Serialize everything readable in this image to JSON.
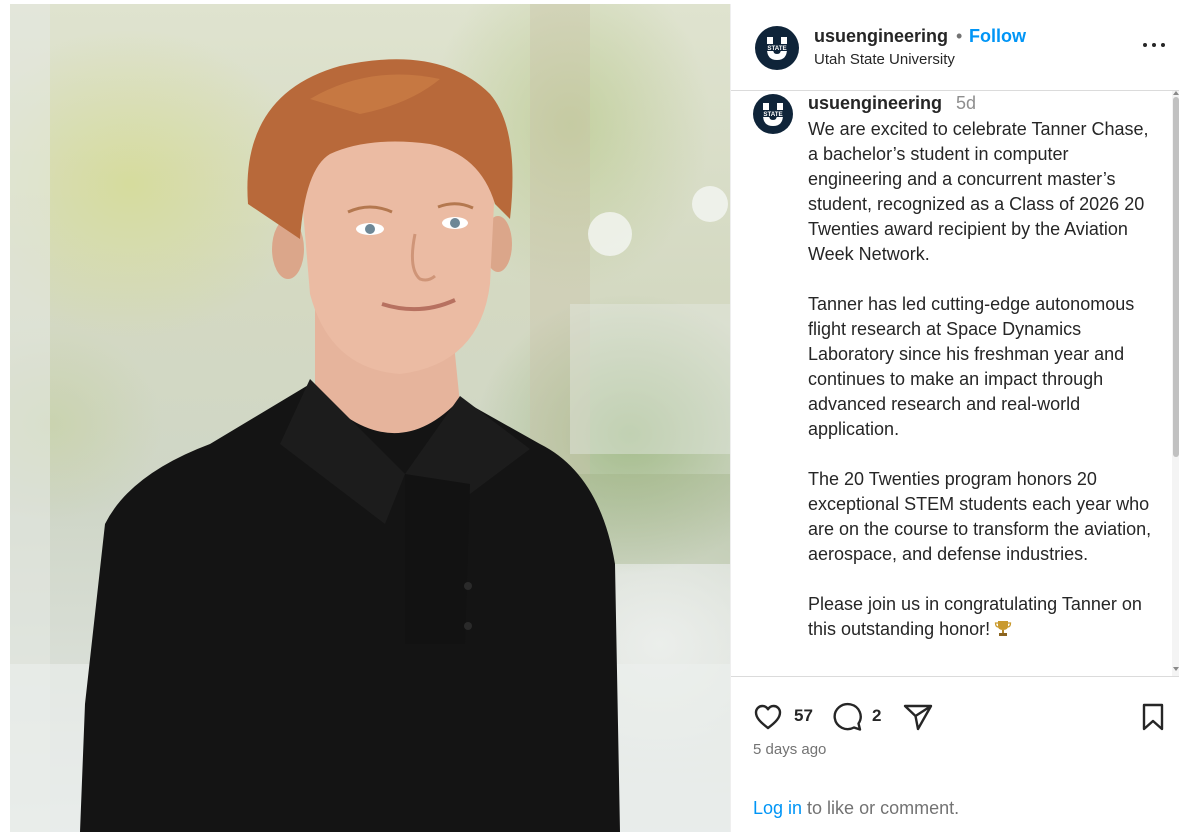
{
  "post": {
    "username": "usuengineering",
    "separator": "•",
    "follow_label": "Follow",
    "location": "Utah State University",
    "caption_time": "5d",
    "caption_paragraphs": [
      "We are excited to celebrate Tanner Chase, a bachelor’s student in computer engineering and a concurrent master’s student, recognized as a Class of 2026 20 Twenties award recipient by the Aviation Week Network.",
      "Tanner has led cutting-edge autonomous flight research at Space Dynamics Laboratory since his freshman year and continues to make an impact through advanced research and real-world application.",
      "The 20 Twenties program honors 20 exceptional STEM students each year who are on the course to transform the aviation, aerospace, and defense industries.",
      "Please join us in congratulating Tanner on this outstanding honor!"
    ],
    "likes": "57",
    "comments": "2",
    "posted_ago": "5 days ago",
    "login_link": "Log in",
    "login_suffix": " to like or comment."
  },
  "icons": {
    "avatar": "usu-state-logo",
    "more": "more-horizontal-icon",
    "like": "heart-icon",
    "comment": "comment-icon",
    "share": "share-icon",
    "save": "bookmark-icon",
    "trophy": "trophy-emoji"
  },
  "colors": {
    "follow": "#0095f6",
    "link": "#0095f6",
    "avatar_bg": "#0f2439",
    "shirt": "#111111",
    "hair": "#b96c35"
  }
}
